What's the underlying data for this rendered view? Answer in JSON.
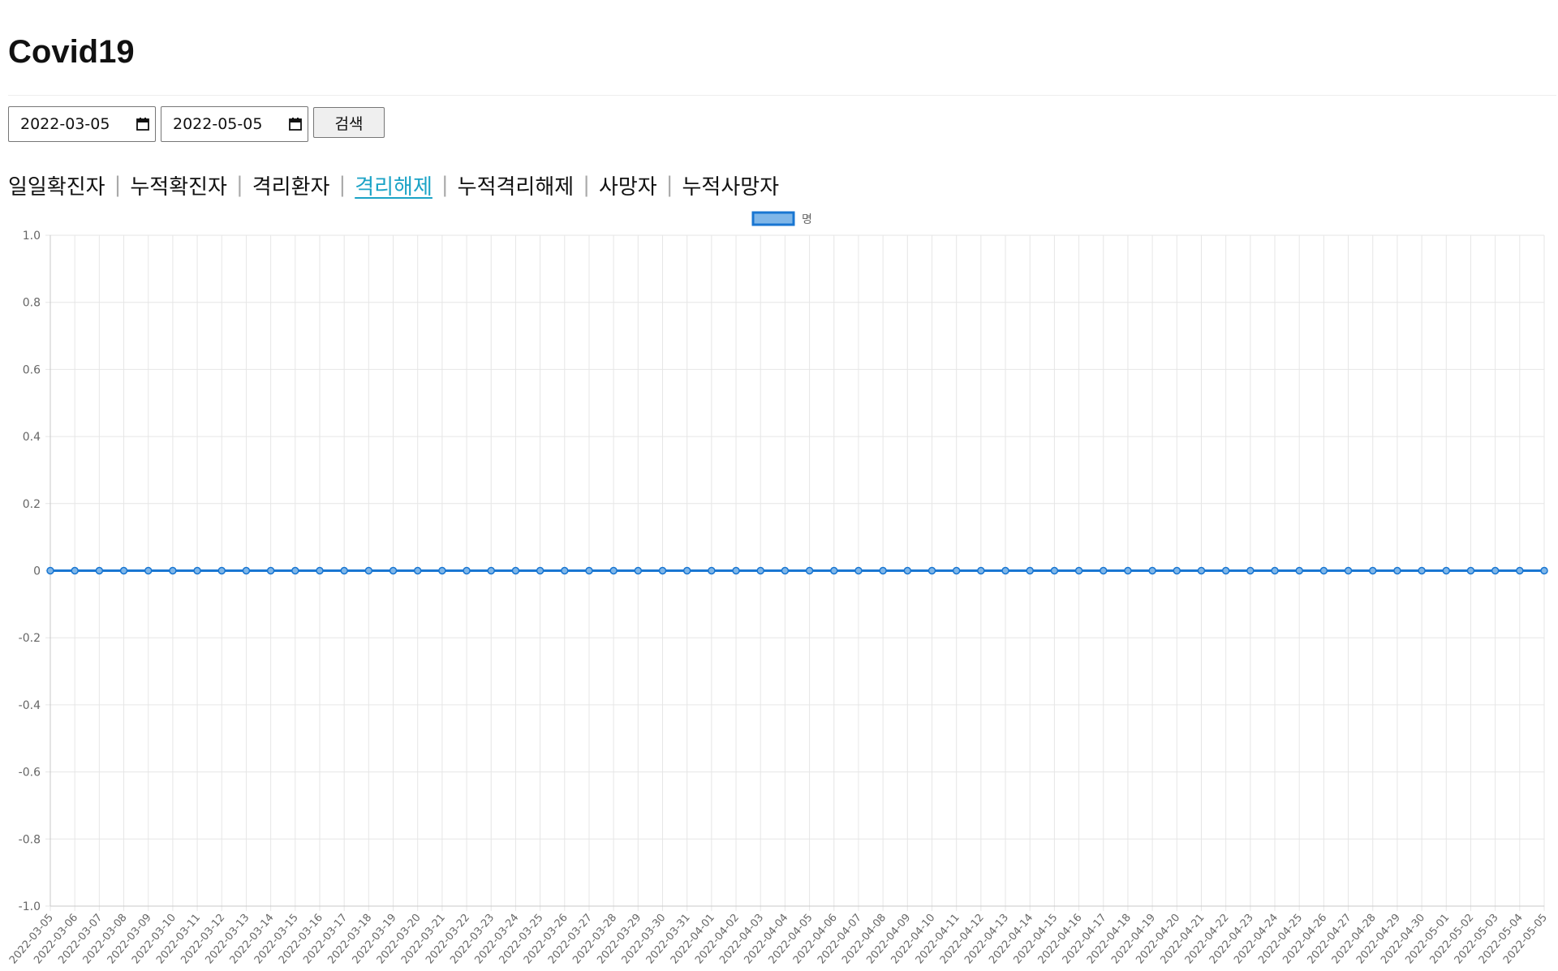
{
  "page": {
    "title": "Covid19"
  },
  "search": {
    "start_date": "2022-03-05",
    "end_date": "2022-05-05",
    "button_label": "검색"
  },
  "tabs": [
    {
      "label": "일일확진자",
      "active": false
    },
    {
      "label": "누적확진자",
      "active": false
    },
    {
      "label": "격리환자",
      "active": false
    },
    {
      "label": "격리해제",
      "active": true
    },
    {
      "label": "누적격리해제",
      "active": false
    },
    {
      "label": "사망자",
      "active": false
    },
    {
      "label": "누적사망자",
      "active": false
    }
  ],
  "tab_separator": "|",
  "colors": {
    "line": "#1976d2",
    "legend_fill": "#7fb6e8",
    "active_tab": "#1ba3c6"
  },
  "chart_data": {
    "type": "line",
    "title": "",
    "xlabel": "",
    "ylabel": "",
    "ylim": [
      -1.0,
      1.0
    ],
    "y_ticks": [
      "1.0",
      "0.8",
      "0.6",
      "0.4",
      "0.2",
      "0",
      "-0.2",
      "-0.4",
      "-0.6",
      "-0.8",
      "-1.0"
    ],
    "grid": true,
    "legend_position": "top-center",
    "categories": [
      "2022-03-05",
      "2022-03-06",
      "2022-03-07",
      "2022-03-08",
      "2022-03-09",
      "2022-03-10",
      "2022-03-11",
      "2022-03-12",
      "2022-03-13",
      "2022-03-14",
      "2022-03-15",
      "2022-03-16",
      "2022-03-17",
      "2022-03-18",
      "2022-03-19",
      "2022-03-20",
      "2022-03-21",
      "2022-03-22",
      "2022-03-23",
      "2022-03-24",
      "2022-03-25",
      "2022-03-26",
      "2022-03-27",
      "2022-03-28",
      "2022-03-29",
      "2022-03-30",
      "2022-03-31",
      "2022-04-01",
      "2022-04-02",
      "2022-04-03",
      "2022-04-04",
      "2022-04-05",
      "2022-04-06",
      "2022-04-07",
      "2022-04-08",
      "2022-04-09",
      "2022-04-10",
      "2022-04-11",
      "2022-04-12",
      "2022-04-13",
      "2022-04-14",
      "2022-04-15",
      "2022-04-16",
      "2022-04-17",
      "2022-04-18",
      "2022-04-19",
      "2022-04-20",
      "2022-04-21",
      "2022-04-22",
      "2022-04-23",
      "2022-04-24",
      "2022-04-25",
      "2022-04-26",
      "2022-04-27",
      "2022-04-28",
      "2022-04-29",
      "2022-04-30",
      "2022-05-01",
      "2022-05-02",
      "2022-05-03",
      "2022-05-04",
      "2022-05-05"
    ],
    "series": [
      {
        "name": "명",
        "values": [
          0,
          0,
          0,
          0,
          0,
          0,
          0,
          0,
          0,
          0,
          0,
          0,
          0,
          0,
          0,
          0,
          0,
          0,
          0,
          0,
          0,
          0,
          0,
          0,
          0,
          0,
          0,
          0,
          0,
          0,
          0,
          0,
          0,
          0,
          0,
          0,
          0,
          0,
          0,
          0,
          0,
          0,
          0,
          0,
          0,
          0,
          0,
          0,
          0,
          0,
          0,
          0,
          0,
          0,
          0,
          0,
          0,
          0,
          0,
          0,
          0,
          0
        ]
      }
    ]
  }
}
